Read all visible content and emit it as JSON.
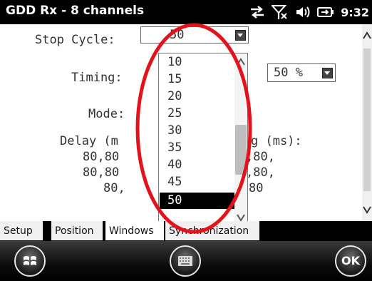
{
  "status_bar": {
    "title": "GDD Rx - 8 channels",
    "time": "9:32",
    "icons": [
      "sync-icon",
      "signal-off-icon",
      "volume-icon",
      "battery-icon"
    ]
  },
  "form": {
    "stop_cycle_label": "Stop Cycle:",
    "stop_cycle_value": "50",
    "timing_label": "Timing:",
    "timing_value": "50 %",
    "mode_label": "Mode:",
    "delay_label": "Delay (m",
    "delay_rows": [
      "80,80",
      "80,80",
      "80,"
    ],
    "width_label": "g (ms):",
    "width_rows": [
      ",80,",
      ",80,",
      "80"
    ]
  },
  "dropdown": {
    "options": [
      "10",
      "15",
      "20",
      "25",
      "30",
      "35",
      "40",
      "45",
      "50"
    ],
    "selected": "50"
  },
  "tabs": [
    {
      "label": "Setup"
    },
    {
      "label": "Position"
    },
    {
      "label": "Windows"
    },
    {
      "label": "Synchronization"
    }
  ],
  "active_tab": "Windows",
  "softkeys": {
    "ok_label": "OK"
  },
  "annotation_color": "#e4131b"
}
